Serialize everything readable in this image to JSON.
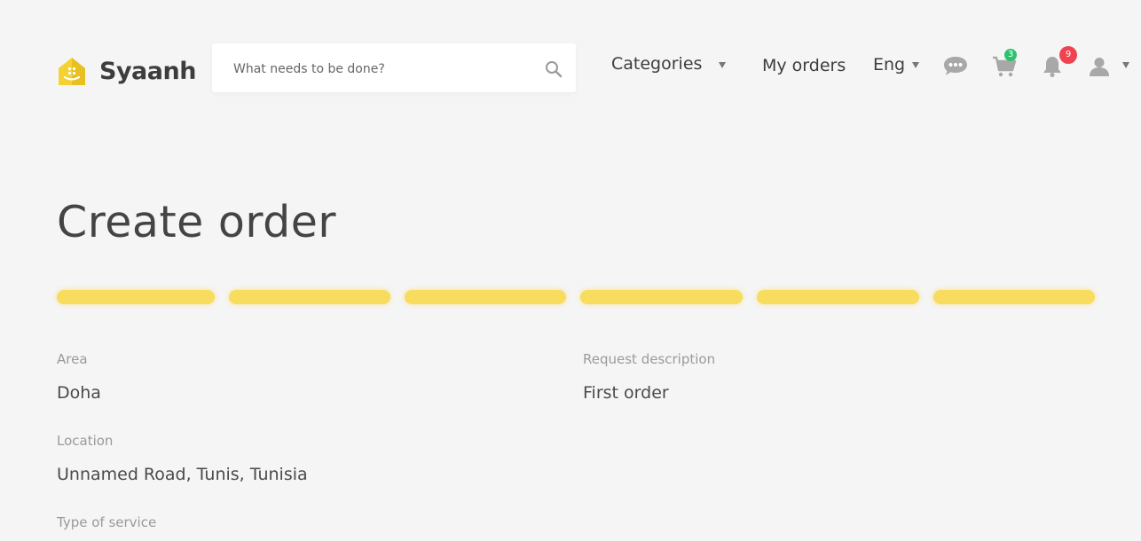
{
  "brand": {
    "name": "Syaanh",
    "logo_color": "#f5d233"
  },
  "search": {
    "placeholder": "What needs to be done?"
  },
  "nav": {
    "categories_label": "Categories",
    "my_orders_label": "My orders",
    "language_label": "Eng",
    "cart_count": "3",
    "notification_count": "9"
  },
  "page": {
    "title": "Create order"
  },
  "progress": {
    "total_steps": 6,
    "completed_steps": 6,
    "color": "#f8dc5e"
  },
  "fields": {
    "area_label": "Area",
    "area_value": "Doha",
    "description_label": "Request description",
    "description_value": "First order",
    "location_label": "Location",
    "location_value": "Unnamed Road, Tunis, Tunisia",
    "service_label": "Type of service"
  },
  "colors": {
    "cart_badge": "#2bc26b",
    "notification_badge": "#ef4350",
    "icon_gray": "#a8a8a8"
  }
}
